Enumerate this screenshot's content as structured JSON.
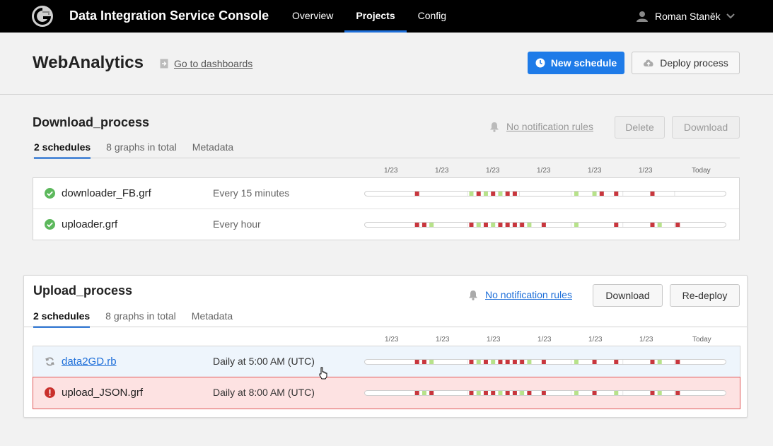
{
  "app": {
    "title": "Data Integration Service Console",
    "logo_icon": "g-logo-icon"
  },
  "nav": {
    "items": [
      {
        "label": "Overview"
      },
      {
        "label": "Projects"
      },
      {
        "label": "Config"
      }
    ],
    "active": 1
  },
  "user": {
    "name": "Roman Staněk"
  },
  "project": {
    "title": "WebAnalytics",
    "goto_dashboards": "Go to dashboards",
    "new_schedule": "New schedule",
    "deploy_process": "Deploy process"
  },
  "timeline_dates": [
    "1/23",
    "1/23",
    "1/23",
    "1/23",
    "1/23",
    "1/23",
    "Today"
  ],
  "colors": {
    "accent": "#1e7be8",
    "success": "#5cb85c",
    "error": "#c9302c",
    "run_ok": "#b7e28a",
    "run_fail": "#c8363d"
  },
  "processes": [
    {
      "name": "Download_process",
      "notification": "No notification rules",
      "btn1": "Delete",
      "btn2": "Download",
      "tabs": [
        "2 schedules",
        "8 graphs in total",
        "Metadata"
      ],
      "schedules": [
        {
          "file": "downloader_FB.grf",
          "schedule": "Every 15 minutes",
          "status": "ok",
          "runs": [
            [
              0.14,
              "f"
            ],
            [
              0.29,
              "o"
            ],
            [
              0.31,
              "f"
            ],
            [
              0.33,
              "o"
            ],
            [
              0.35,
              "f"
            ],
            [
              0.37,
              "o"
            ],
            [
              0.39,
              "f"
            ],
            [
              0.41,
              "f"
            ],
            [
              0.58,
              "o"
            ],
            [
              0.63,
              "o"
            ],
            [
              0.65,
              "f"
            ],
            [
              0.69,
              "f"
            ],
            [
              0.79,
              "f"
            ]
          ]
        },
        {
          "file": "uploader.grf",
          "schedule": "Every hour",
          "status": "ok",
          "runs": [
            [
              0.14,
              "f"
            ],
            [
              0.16,
              "f"
            ],
            [
              0.18,
              "o"
            ],
            [
              0.29,
              "f"
            ],
            [
              0.31,
              "o"
            ],
            [
              0.33,
              "f"
            ],
            [
              0.35,
              "o"
            ],
            [
              0.37,
              "f"
            ],
            [
              0.39,
              "f"
            ],
            [
              0.41,
              "f"
            ],
            [
              0.43,
              "f"
            ],
            [
              0.45,
              "o"
            ],
            [
              0.49,
              "f"
            ],
            [
              0.58,
              "o"
            ],
            [
              0.69,
              "f"
            ],
            [
              0.79,
              "f"
            ],
            [
              0.81,
              "o"
            ],
            [
              0.86,
              "f"
            ]
          ]
        }
      ]
    },
    {
      "name": "Upload_process",
      "notification": "No notification rules",
      "btn1": "Download",
      "btn2": "Re-deploy",
      "tabs": [
        "2 schedules",
        "8 graphs in total",
        "Metadata"
      ],
      "schedules": [
        {
          "file": "data2GD.rb",
          "schedule": "Daily at 5:00 AM (UTC)",
          "status": "running",
          "runs": [
            [
              0.14,
              "f"
            ],
            [
              0.16,
              "f"
            ],
            [
              0.18,
              "o"
            ],
            [
              0.29,
              "f"
            ],
            [
              0.31,
              "o"
            ],
            [
              0.33,
              "f"
            ],
            [
              0.35,
              "o"
            ],
            [
              0.37,
              "f"
            ],
            [
              0.39,
              "f"
            ],
            [
              0.41,
              "f"
            ],
            [
              0.43,
              "f"
            ],
            [
              0.45,
              "o"
            ],
            [
              0.49,
              "f"
            ],
            [
              0.58,
              "o"
            ],
            [
              0.63,
              "f"
            ],
            [
              0.69,
              "f"
            ],
            [
              0.79,
              "f"
            ],
            [
              0.81,
              "o"
            ],
            [
              0.86,
              "f"
            ]
          ]
        },
        {
          "file": "upload_JSON.grf",
          "schedule": "Daily at 8:00 AM (UTC)",
          "status": "error",
          "runs": [
            [
              0.14,
              "f"
            ],
            [
              0.16,
              "o"
            ],
            [
              0.18,
              "f"
            ],
            [
              0.29,
              "f"
            ],
            [
              0.31,
              "o"
            ],
            [
              0.33,
              "f"
            ],
            [
              0.35,
              "f"
            ],
            [
              0.37,
              "o"
            ],
            [
              0.39,
              "f"
            ],
            [
              0.41,
              "f"
            ],
            [
              0.43,
              "o"
            ],
            [
              0.45,
              "f"
            ],
            [
              0.49,
              "f"
            ],
            [
              0.58,
              "o"
            ],
            [
              0.63,
              "f"
            ],
            [
              0.69,
              "o"
            ],
            [
              0.79,
              "f"
            ],
            [
              0.81,
              "o"
            ],
            [
              0.86,
              "f"
            ]
          ]
        }
      ]
    }
  ]
}
